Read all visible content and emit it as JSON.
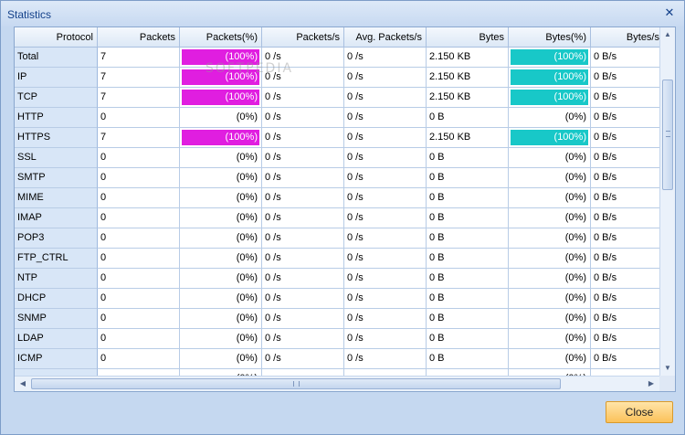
{
  "window": {
    "title": "Statistics",
    "close_glyph": "✕"
  },
  "watermark": "SOFTPEDIA",
  "colors": {
    "packets_bar": "#e01ee0",
    "bytes_bar": "#18c8c8",
    "button_bg": "#fbc25a"
  },
  "columns": [
    "Protocol",
    "Packets",
    "Packets(%)",
    "Packets/s",
    "Avg. Packets/s",
    "Bytes",
    "Bytes(%)",
    "Bytes/s"
  ],
  "rows": [
    {
      "protocol": "Total",
      "packets": "7",
      "packets_pct": "(100%)",
      "packets_fill": 100,
      "packets_s": "0 /s",
      "avg_packets_s": "0 /s",
      "bytes": "2.150 KB",
      "bytes_pct": "(100%)",
      "bytes_fill": 100,
      "bytes_s": "0 B/s"
    },
    {
      "protocol": "IP",
      "packets": "7",
      "packets_pct": "(100%)",
      "packets_fill": 100,
      "packets_s": "0 /s",
      "avg_packets_s": "0 /s",
      "bytes": "2.150 KB",
      "bytes_pct": "(100%)",
      "bytes_fill": 100,
      "bytes_s": "0 B/s"
    },
    {
      "protocol": "TCP",
      "packets": "7",
      "packets_pct": "(100%)",
      "packets_fill": 100,
      "packets_s": "0 /s",
      "avg_packets_s": "0 /s",
      "bytes": "2.150 KB",
      "bytes_pct": "(100%)",
      "bytes_fill": 100,
      "bytes_s": "0 B/s"
    },
    {
      "protocol": "HTTP",
      "packets": "0",
      "packets_pct": "(0%)",
      "packets_fill": 0,
      "packets_s": "0 /s",
      "avg_packets_s": "0 /s",
      "bytes": "0 B",
      "bytes_pct": "(0%)",
      "bytes_fill": 0,
      "bytes_s": "0 B/s"
    },
    {
      "protocol": "HTTPS",
      "packets": "7",
      "packets_pct": "(100%)",
      "packets_fill": 100,
      "packets_s": "0 /s",
      "avg_packets_s": "0 /s",
      "bytes": "2.150 KB",
      "bytes_pct": "(100%)",
      "bytes_fill": 100,
      "bytes_s": "0 B/s"
    },
    {
      "protocol": "SSL",
      "packets": "0",
      "packets_pct": "(0%)",
      "packets_fill": 0,
      "packets_s": "0 /s",
      "avg_packets_s": "0 /s",
      "bytes": "0 B",
      "bytes_pct": "(0%)",
      "bytes_fill": 0,
      "bytes_s": "0 B/s"
    },
    {
      "protocol": "SMTP",
      "packets": "0",
      "packets_pct": "(0%)",
      "packets_fill": 0,
      "packets_s": "0 /s",
      "avg_packets_s": "0 /s",
      "bytes": "0 B",
      "bytes_pct": "(0%)",
      "bytes_fill": 0,
      "bytes_s": "0 B/s"
    },
    {
      "protocol": "MIME",
      "packets": "0",
      "packets_pct": "(0%)",
      "packets_fill": 0,
      "packets_s": "0 /s",
      "avg_packets_s": "0 /s",
      "bytes": "0 B",
      "bytes_pct": "(0%)",
      "bytes_fill": 0,
      "bytes_s": "0 B/s"
    },
    {
      "protocol": "IMAP",
      "packets": "0",
      "packets_pct": "(0%)",
      "packets_fill": 0,
      "packets_s": "0 /s",
      "avg_packets_s": "0 /s",
      "bytes": "0 B",
      "bytes_pct": "(0%)",
      "bytes_fill": 0,
      "bytes_s": "0 B/s"
    },
    {
      "protocol": "POP3",
      "packets": "0",
      "packets_pct": "(0%)",
      "packets_fill": 0,
      "packets_s": "0 /s",
      "avg_packets_s": "0 /s",
      "bytes": "0 B",
      "bytes_pct": "(0%)",
      "bytes_fill": 0,
      "bytes_s": "0 B/s"
    },
    {
      "protocol": "FTP_CTRL",
      "packets": "0",
      "packets_pct": "(0%)",
      "packets_fill": 0,
      "packets_s": "0 /s",
      "avg_packets_s": "0 /s",
      "bytes": "0 B",
      "bytes_pct": "(0%)",
      "bytes_fill": 0,
      "bytes_s": "0 B/s"
    },
    {
      "protocol": "NTP",
      "packets": "0",
      "packets_pct": "(0%)",
      "packets_fill": 0,
      "packets_s": "0 /s",
      "avg_packets_s": "0 /s",
      "bytes": "0 B",
      "bytes_pct": "(0%)",
      "bytes_fill": 0,
      "bytes_s": "0 B/s"
    },
    {
      "protocol": "DHCP",
      "packets": "0",
      "packets_pct": "(0%)",
      "packets_fill": 0,
      "packets_s": "0 /s",
      "avg_packets_s": "0 /s",
      "bytes": "0 B",
      "bytes_pct": "(0%)",
      "bytes_fill": 0,
      "bytes_s": "0 B/s"
    },
    {
      "protocol": "SNMP",
      "packets": "0",
      "packets_pct": "(0%)",
      "packets_fill": 0,
      "packets_s": "0 /s",
      "avg_packets_s": "0 /s",
      "bytes": "0 B",
      "bytes_pct": "(0%)",
      "bytes_fill": 0,
      "bytes_s": "0 B/s"
    },
    {
      "protocol": "LDAP",
      "packets": "0",
      "packets_pct": "(0%)",
      "packets_fill": 0,
      "packets_s": "0 /s",
      "avg_packets_s": "0 /s",
      "bytes": "0 B",
      "bytes_pct": "(0%)",
      "bytes_fill": 0,
      "bytes_s": "0 B/s"
    },
    {
      "protocol": "ICMP",
      "packets": "0",
      "packets_pct": "(0%)",
      "packets_fill": 0,
      "packets_s": "0 /s",
      "avg_packets_s": "0 /s",
      "bytes": "0 B",
      "bytes_pct": "(0%)",
      "bytes_fill": 0,
      "bytes_s": "0 B/s"
    },
    {
      "protocol": "",
      "packets": "",
      "packets_pct": "(0%)",
      "packets_fill": 0,
      "packets_s": "",
      "avg_packets_s": "",
      "bytes": "",
      "bytes_pct": "(0%)",
      "bytes_fill": 0,
      "bytes_s": ""
    }
  ],
  "buttons": {
    "close_label": "Close"
  }
}
